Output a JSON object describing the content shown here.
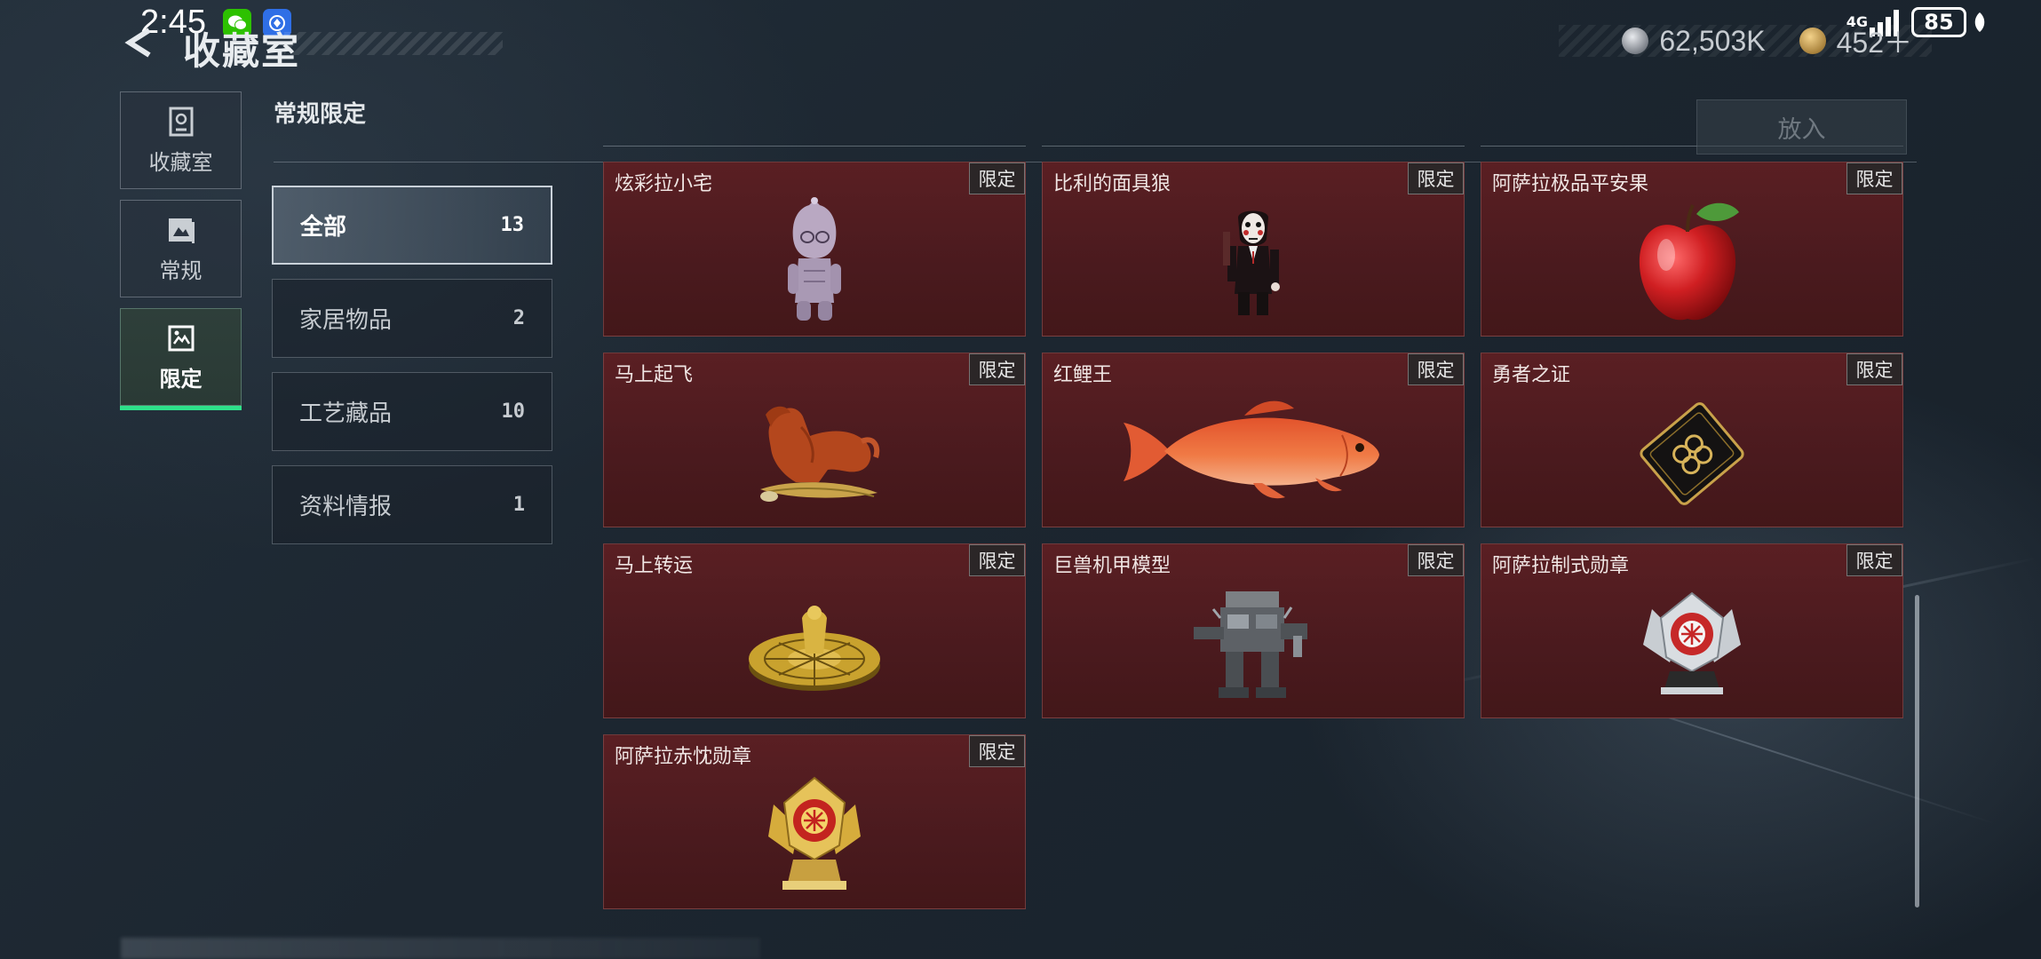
{
  "status_bar": {
    "time": "2:45",
    "network": "4G",
    "battery": "85"
  },
  "header": {
    "title": "收藏室",
    "currencies": [
      {
        "icon": "silver-coin-icon",
        "value": "62,503K"
      },
      {
        "icon": "gold-coin-icon",
        "value": "452＋"
      }
    ]
  },
  "left_nav": [
    {
      "label": "收藏室",
      "icon": "collection-room-icon",
      "active": false
    },
    {
      "label": "常规",
      "icon": "regular-album-icon",
      "active": false
    },
    {
      "label": "限定",
      "icon": "limited-gallery-icon",
      "active": true
    }
  ],
  "section": {
    "title": "常规限定",
    "categories": [
      {
        "label": "全部",
        "count": "13",
        "active": true
      },
      {
        "label": "家居物品",
        "count": "2",
        "active": false
      },
      {
        "label": "工艺藏品",
        "count": "10",
        "active": false
      },
      {
        "label": "资料情报",
        "count": "1",
        "active": false
      }
    ]
  },
  "actions": {
    "put_in": "放入"
  },
  "items": [
    {
      "name": "炫彩拉小宅",
      "badge": "限定",
      "art": "figurine"
    },
    {
      "name": "比利的面具狼",
      "badge": "限定",
      "art": "puppet"
    },
    {
      "name": "阿萨拉极品平安果",
      "badge": "限定",
      "art": "apple"
    },
    {
      "name": "马上起飞",
      "badge": "限定",
      "art": "horse"
    },
    {
      "name": "红鲤王",
      "badge": "限定",
      "art": "carp"
    },
    {
      "name": "勇者之证",
      "badge": "限定",
      "art": "card"
    },
    {
      "name": "马上转运",
      "badge": "限定",
      "art": "gold-disc"
    },
    {
      "name": "巨兽机甲模型",
      "badge": "限定",
      "art": "mech"
    },
    {
      "name": "阿萨拉制式勋章",
      "badge": "限定",
      "art": "silver-medal"
    },
    {
      "name": "阿萨拉赤忱勋章",
      "badge": "限定",
      "art": "gold-medal"
    }
  ],
  "colors": {
    "card_bg": "#4a1a1e",
    "active_nav_underline": "#2ee08a",
    "page_bg": "#1b2530"
  }
}
